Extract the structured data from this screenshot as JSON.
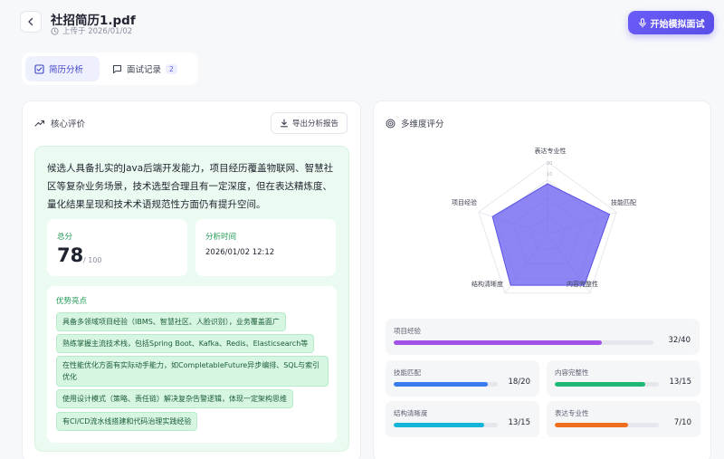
{
  "header": {
    "file_name": "社招简历1.pdf",
    "upload_info": "上传于 2026/01/02",
    "start_button": "开始模拟面试"
  },
  "tabs": [
    {
      "label": "简历分析",
      "active": true
    },
    {
      "label": "面试记录",
      "badge": "2",
      "active": false
    }
  ],
  "evaluation": {
    "title": "核心评价",
    "export_button": "导出分析报告",
    "summary": "候选人具备扎实的Java后端开发能力，项目经历覆盖物联网、智慧社区等复杂业务场景，技术选型合理且有一定深度，但在表达精炼度、量化结果呈现和技术术语规范性方面仍有提升空间。",
    "score_label": "总分",
    "score": "78",
    "score_total": "/ 100",
    "time_label": "分析时间",
    "time_value": "2026/01/02 12:12",
    "strengths_title": "优势亮点",
    "strengths": [
      "具备多领域项目经验（IBMS、智慧社区、人脸识别），业务覆盖面广",
      "熟练掌握主流技术栈，包括Spring Boot、Kafka、Redis、Elasticsearch等",
      "在性能优化方面有实际动手能力，如CompletableFuture异步编排、SQL与索引优化",
      "使用设计模式（策略、责任链）解决复杂告警逻辑，体现一定架构思维",
      "有CI/CD流水线搭建和代码治理实践经验"
    ]
  },
  "dimensions": {
    "title": "多维度评分",
    "radar_labels": [
      "表达专业性",
      "技能匹配",
      "内容完整性",
      "结构清晰度",
      "项目经验"
    ],
    "radar_ticks": [
      "10",
      "20"
    ],
    "accent_color": "#6c63f0",
    "items": [
      {
        "label": "项目经验",
        "score": 32,
        "max": 40,
        "display": "32/40",
        "color": "#a352e8"
      },
      {
        "label": "技能匹配",
        "score": 18,
        "max": 20,
        "display": "18/20",
        "color": "#3b7bf0"
      },
      {
        "label": "内容完整性",
        "score": 13,
        "max": 15,
        "display": "13/15",
        "color": "#20b877"
      },
      {
        "label": "结构清晰度",
        "score": 13,
        "max": 15,
        "display": "13/15",
        "color": "#13b6d8"
      },
      {
        "label": "表达专业性",
        "score": 7,
        "max": 10,
        "display": "7/10",
        "color": "#f26e1f"
      }
    ]
  }
}
